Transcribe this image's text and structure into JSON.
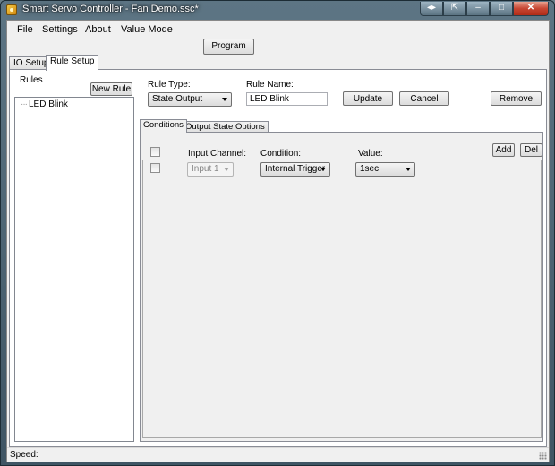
{
  "window": {
    "title": "Smart Servo Controller - Fan Demo.ssc*",
    "buttons": {
      "extra_1": "◂▸",
      "extra_2": "⇱",
      "minimize": "–",
      "maximize": "□",
      "close": "✕"
    }
  },
  "menu": [
    "File",
    "Settings",
    "About",
    "Value Mode"
  ],
  "toolbar": {
    "program_label": "Program"
  },
  "tabs": [
    {
      "label": "IO Setup",
      "active": false
    },
    {
      "label": "Rule Setup",
      "active": true
    }
  ],
  "rules": {
    "label": "Rules",
    "new_rule_label": "New Rule",
    "items": [
      {
        "prefix": "···",
        "label": "LED Blink"
      }
    ]
  },
  "editor": {
    "rule_type_label": "Rule Type:",
    "rule_type_value": "State Output",
    "rule_name_label": "Rule Name:",
    "rule_name_value": "LED Blink",
    "update_label": "Update",
    "cancel_label": "Cancel",
    "remove_label": "Remove"
  },
  "inner_tabs": [
    {
      "label": "Conditions",
      "active": true
    },
    {
      "label": "Output State Options",
      "active": false
    }
  ],
  "conditions": {
    "headers": {
      "input_channel": "Input Channel:",
      "condition": "Condition:",
      "value": "Value:"
    },
    "add_label": "Add",
    "del_label": "Del",
    "rows": [
      {
        "checked": false,
        "input_channel": "Input 1",
        "input_disabled": true,
        "condition": "Internal Trigger",
        "value": "1sec"
      }
    ]
  },
  "status": {
    "label": "Speed:"
  },
  "icons": {
    "app": "app-icon",
    "dropdown": "chevron-down-icon",
    "grip": "resize-grip-icon"
  }
}
